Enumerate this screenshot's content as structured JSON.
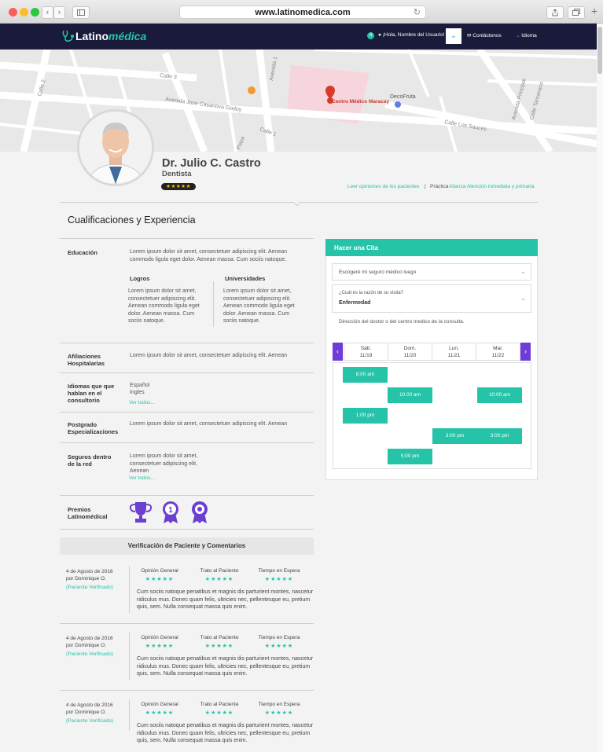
{
  "browser": {
    "url": "www.latinomedica.com",
    "back": "‹",
    "forward": "›",
    "reload": "↻",
    "new_tab": "+"
  },
  "nav": {
    "logo_a": "Latino",
    "logo_b": "médica",
    "notifications": "4",
    "user": "¡Hola, Nombre del Usuario!",
    "contact": "Contáctenos",
    "language": "Idioma"
  },
  "map": {
    "streets": [
      "Calle 3",
      "Avenida 1",
      "Avenida Jose Casanova Godoy",
      "Calle 2",
      "Calle 1",
      "Plaza",
      "Calle Los Sauces",
      "Calle Tamanaco",
      "Avenida Principal"
    ],
    "marker": "Centro Médico Maracay",
    "poi": "DecoFruta"
  },
  "doctor": {
    "name": "Dr. Julio C. Castro",
    "specialty": "Dentista",
    "stars": "★★★★★",
    "reviews_link": "Leer opiniones de los pacientes",
    "practice_label": "Práctica",
    "practice_value": "Alianza Atención inmediata y primaria"
  },
  "section_title": "Cualificaciones y Experiencia",
  "qualifications": {
    "education_label": "Educación",
    "education_text": "Lorem ipsum dolor sit amet, consectetuer adipiscing elit. Aenean commodo ligula eget dolor. Aenean massa. Cum sociis natoque.",
    "achievements_label": "Logros",
    "achievements_text": "Lorem ipsum dolor sit amet, consectetuer adipiscing elit. Aenean commodo ligula eget dolor. Aenean massa. Cum sociis natoque.",
    "universities_label": "Universidades",
    "universities_text": "Lorem ipsum dolor sit amet, consectetuer adipiscing elit. Aenean commodo ligula eget dolor. Aenean massa. Cum sociis natoque.",
    "affiliations_label": "Afiliaciones Hospitalarias",
    "affiliations_text": "Lorem ipsum dolor sit amet, consectetuer adipiscing elit. Aenean",
    "languages_label": "Idiomas que que hablan en el consultorio",
    "languages": [
      "Español",
      "Ingles"
    ],
    "see_all": "Ver todos...",
    "postgrad_label": "Postgrado Especializaciones",
    "postgrad_text": "Lorem ipsum dolor sit amet, consectetuer adipiscing elit. Aenean",
    "insurance_label": "Seguros dentro de la red",
    "insurance_text": "Lorem ipsum dolor sit amet, consectetuer adipiscing elit. Aenean",
    "awards_label": "Premios Latinomédical"
  },
  "appointment": {
    "title": "Hacer una Cita",
    "insurance_select": "Escogeré mi seguro médico luego",
    "reason_label": "¿Cuál es la razón de su visita?",
    "reason_value": "Enfermedad",
    "address": "Dirección del doctor o del centro medico de la consulta.",
    "days": [
      {
        "name": "Sáb.",
        "date": "11/19"
      },
      {
        "name": "Dom.",
        "date": "11/20"
      },
      {
        "name": "Lun.",
        "date": "11/21"
      },
      {
        "name": "Mar.",
        "date": "11/22"
      }
    ],
    "slots": [
      {
        "label": "8:00 am",
        "day": 0,
        "row": 0
      },
      {
        "label": "10:00 am",
        "day": 1,
        "row": 1
      },
      {
        "label": "10:00 am",
        "day": 3,
        "row": 1
      },
      {
        "label": "1:00 pm",
        "day": 0,
        "row": 2
      },
      {
        "label": "3:00 pm",
        "day": 2,
        "row": 3
      },
      {
        "label": "3:00 pm",
        "day": 3,
        "row": 3
      },
      {
        "label": "5:00 pm",
        "day": 1,
        "row": 4
      }
    ]
  },
  "verification": {
    "title": "Verificación de Paciente y Comentarios",
    "reviews": [
      {
        "date": "4 de Agosto de 2016",
        "by": "por Dominique O.",
        "verified": "(Paciente Verificado)",
        "general": "Opinión General",
        "treatment": "Trato al Paciente",
        "wait": "Tiempo en Espera",
        "stars": "★★★★★",
        "comment": "Cum sociis natoque penatibus et magnis dis parturient montes, nascetur ridiculus mus. Donec quam felis, ultricies nec, pellentesque eu, pretium quis, sem. Nulla consequat massa quis enim."
      },
      {
        "date": "4 de Agosto de 2016",
        "by": "por Dominique O.",
        "verified": "(Paciente Verificado)",
        "general": "Opinión General",
        "treatment": "Trato al Paciente",
        "wait": "Tiempo en Espera",
        "stars": "★★★★★",
        "comment": "Cum sociis natoque penatibus et magnis dis parturient montes, nascetur ridiculus mus. Donec quam felis, ultricies nec, pellentesque eu, pretium quis, sem. Nulla consequat massa quis enim."
      },
      {
        "date": "4 de Agosto de 2016",
        "by": "por Dominique O.",
        "verified": "(Paciente Verificado)",
        "general": "Opinión General",
        "treatment": "Trato al Paciente",
        "wait": "Tiempo en Espera",
        "stars": "★★★★★",
        "comment": "Cum sociis natoque penatibus et magnis dis parturient montes, nascetur ridiculus mus. Donec quam felis, ultricies nec, pellentesque eu, pretium quis, sem. Nulla consequat massa quis enim."
      }
    ]
  },
  "colors": {
    "accent": "#25c3a8",
    "nav": "#1a1b3a",
    "purple": "#6e3cd6"
  }
}
